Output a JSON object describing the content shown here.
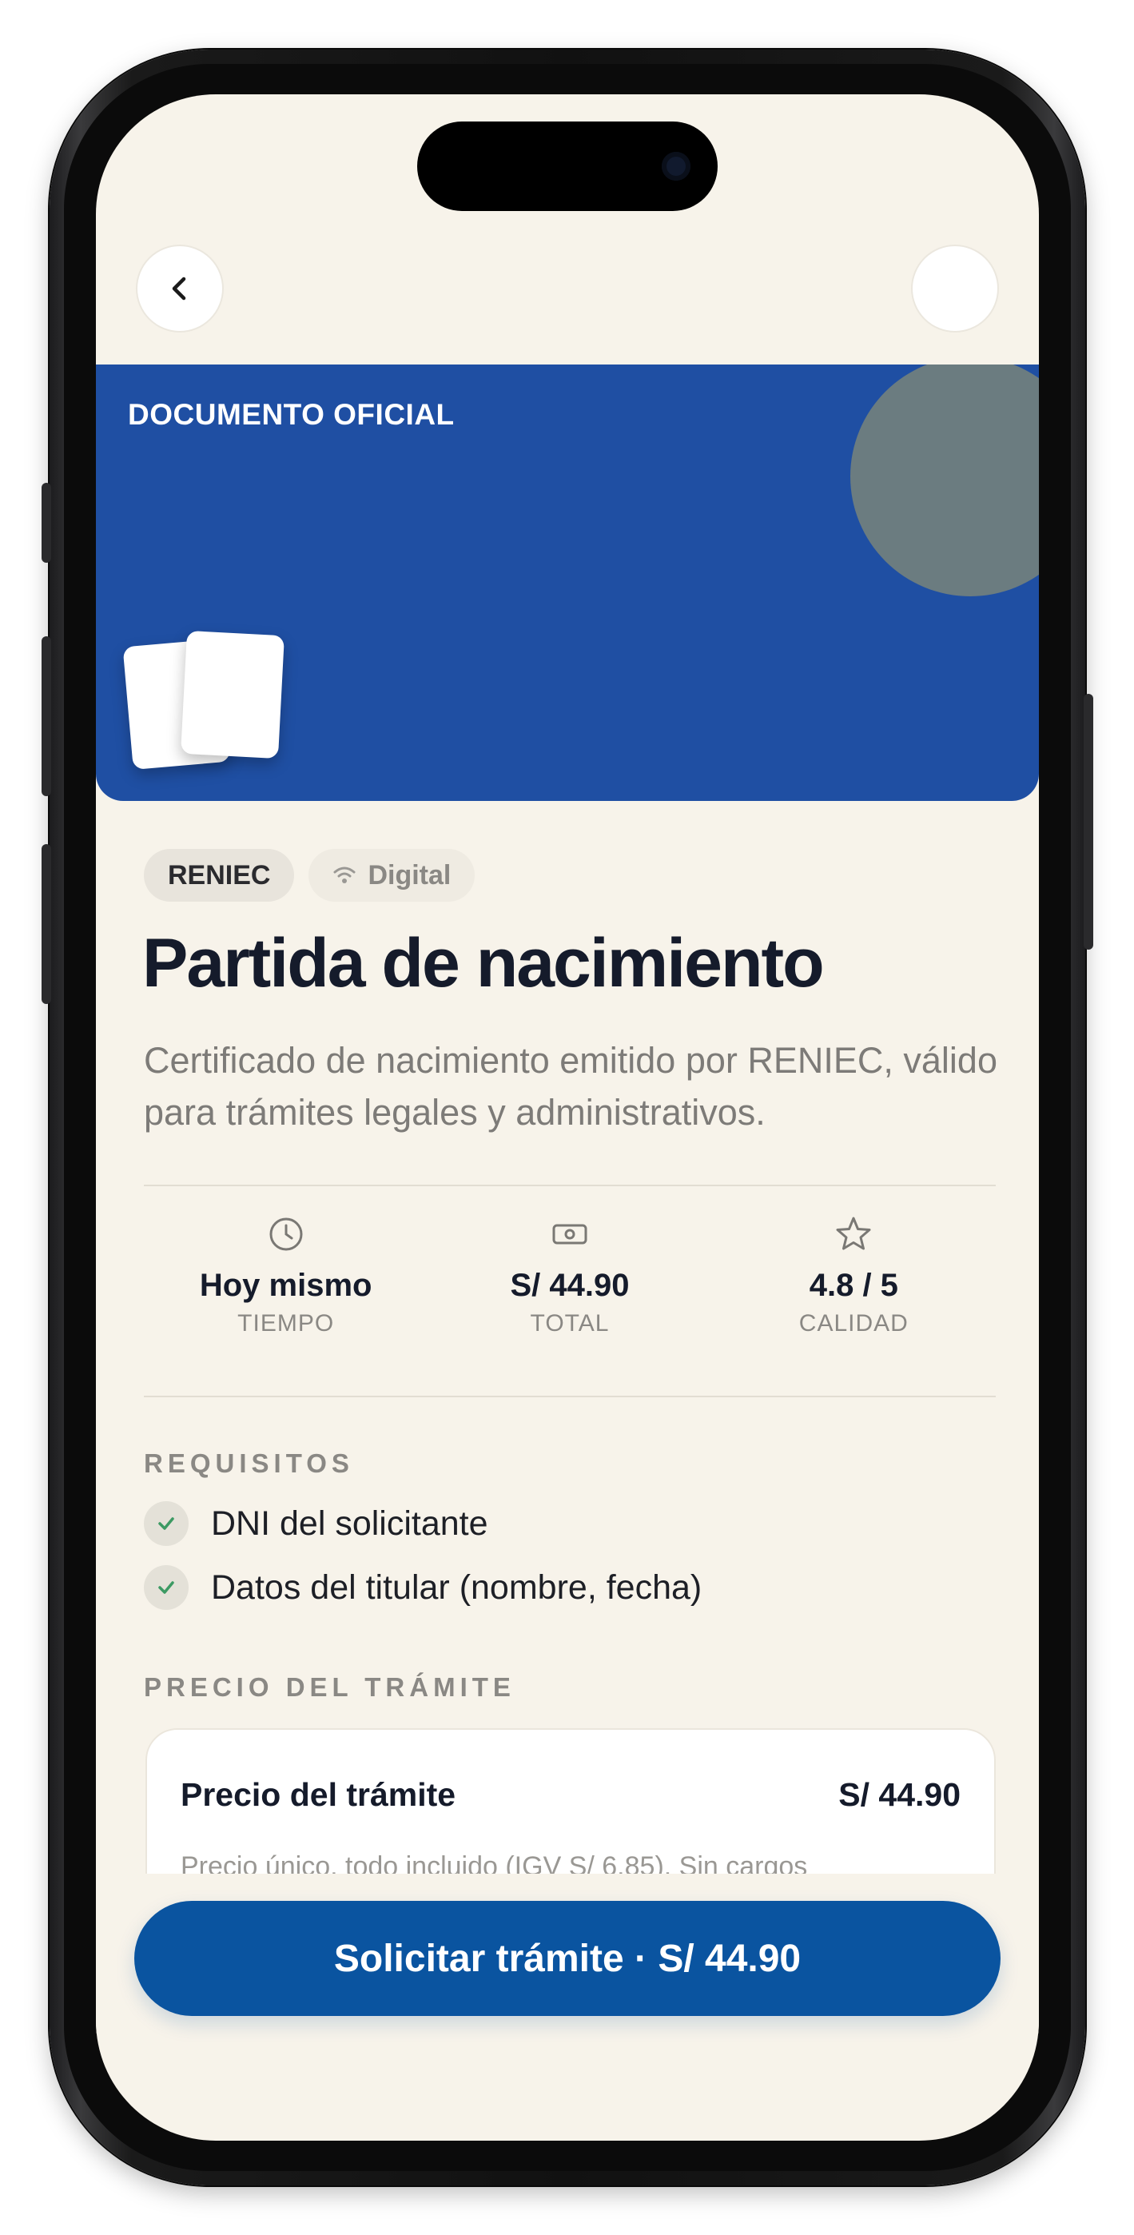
{
  "hero": {
    "tag": "DOCUMENTO OFICIAL",
    "color": "#1f4fa3"
  },
  "chips": {
    "entity": "RENIEC",
    "mode": "Digital"
  },
  "service": {
    "title": "Partida de nacimiento",
    "description": "Certificado de nacimiento emitido por RENIEC, válido para trámites legales y administrativos."
  },
  "stats": [
    {
      "icon": "clock-icon",
      "value": "Hoy mismo",
      "label": "TIEMPO"
    },
    {
      "icon": "cash-icon",
      "value": "S/ 44.90",
      "label": "TOTAL"
    },
    {
      "icon": "star-icon",
      "value": "4.8 / 5",
      "label": "CALIDAD"
    }
  ],
  "requirements": {
    "heading": "REQUISITOS",
    "items": [
      "DNI del solicitante",
      "Datos del titular (nombre, fecha)"
    ]
  },
  "price": {
    "heading": "PRECIO DEL TRÁMITE",
    "title": "Precio del trámite",
    "value": "S/ 44.90",
    "note": "Precio único, todo incluido (IGV S/ 6.85). Sin cargos"
  },
  "cta": {
    "label": "Solicitar trámite · S/  44.90",
    "color": "#0a54a0"
  }
}
